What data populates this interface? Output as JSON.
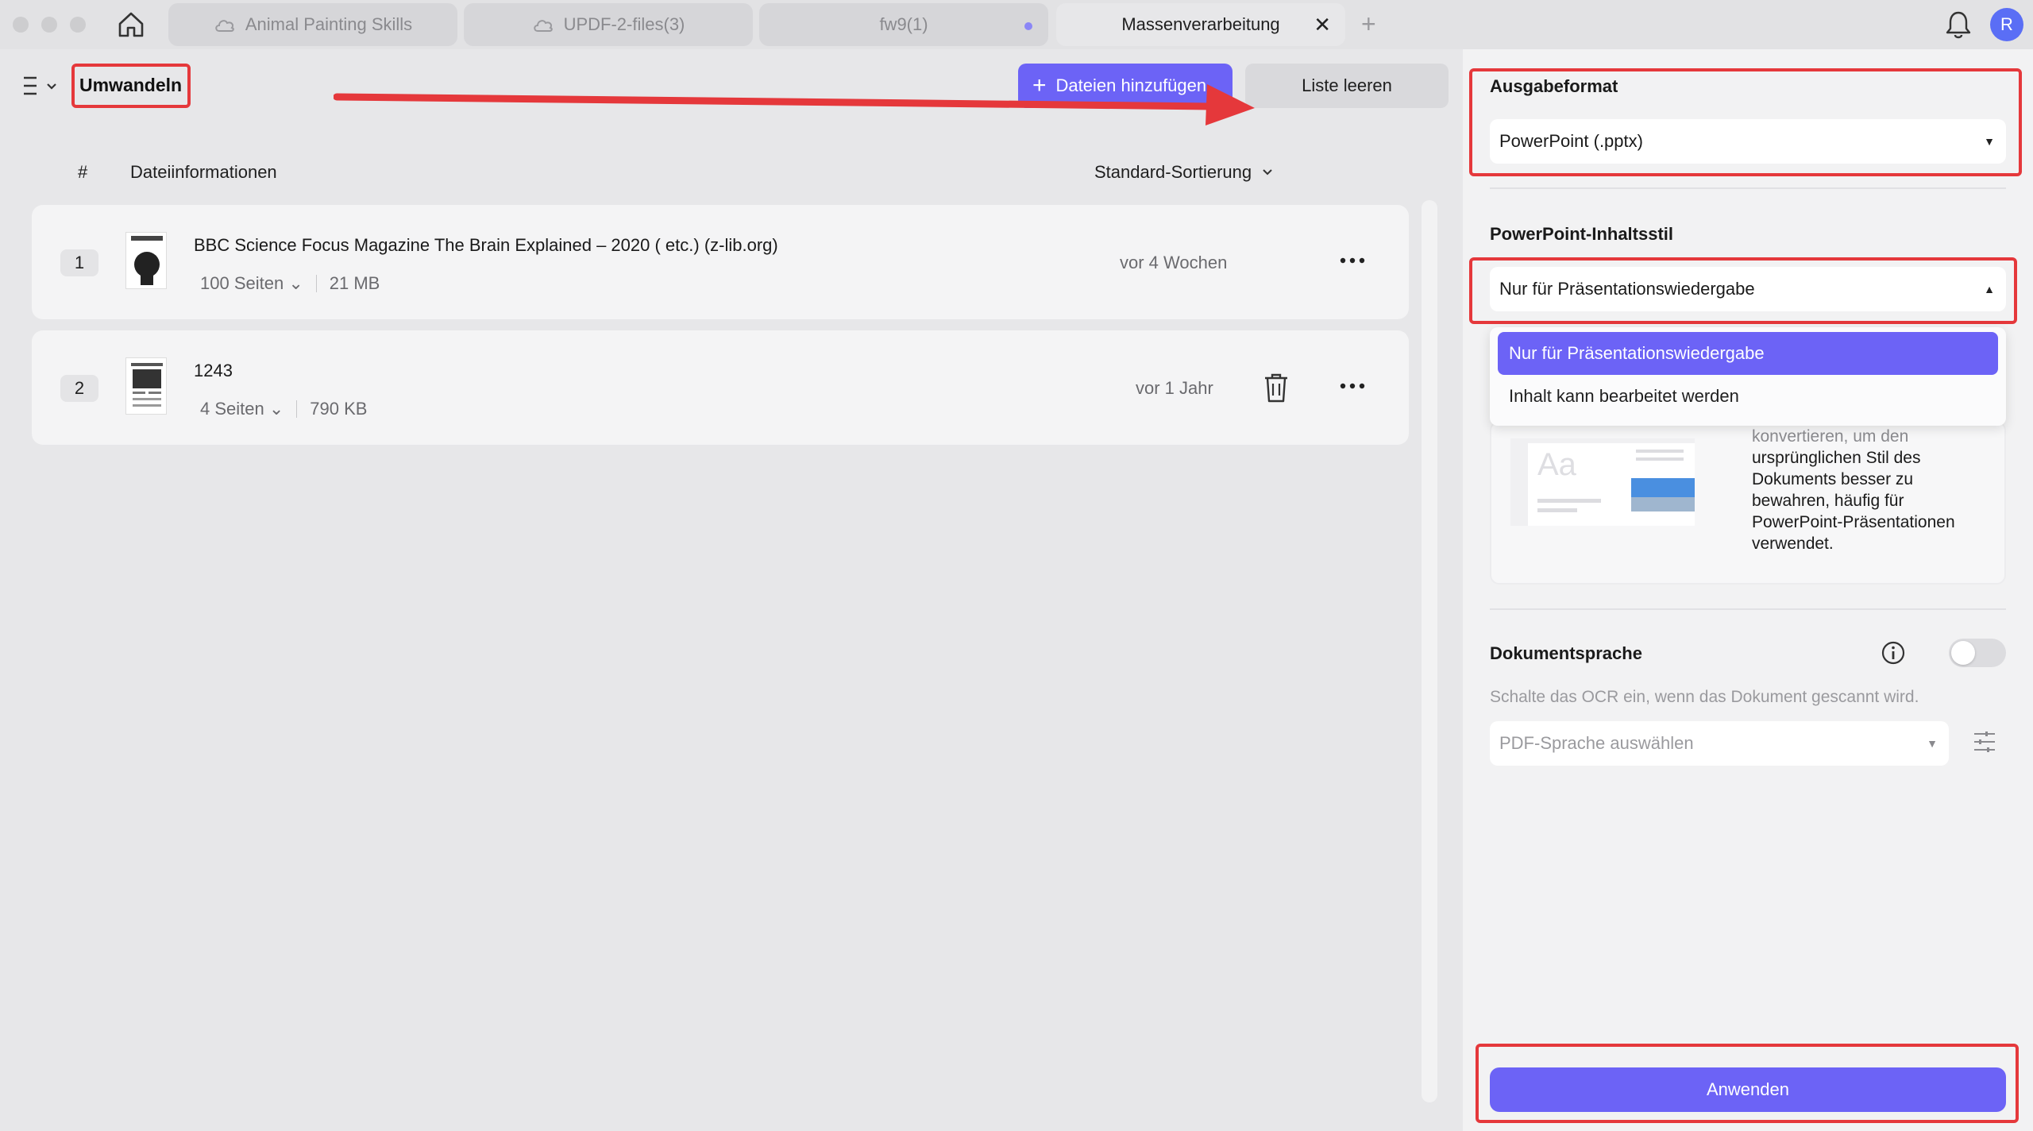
{
  "tabs": [
    {
      "label": "Animal Painting Skills",
      "icon": "cloud-icon"
    },
    {
      "label": "UPDF-2-files(3)",
      "icon": "cloud-icon"
    },
    {
      "label": "fw9(1)"
    },
    {
      "label": "Massenverarbeitung",
      "active": true
    }
  ],
  "user": {
    "avatar_letter": "R"
  },
  "left": {
    "title": "Umwandeln",
    "add_button": "Dateien hinzufügen",
    "clear_button": "Liste leeren",
    "col_hash": "#",
    "col_info": "Dateiinformationen",
    "sort_label": "Standard-Sortierung",
    "files": [
      {
        "num": "1",
        "name": "BBC Science Focus Magazine The Brain Explained – 2020 ( etc.) (z-lib.org)",
        "pages": "100 Seiten",
        "size": "21 MB",
        "date": "vor 4 Wochen"
      },
      {
        "num": "2",
        "name": "1243",
        "pages": "4 Seiten",
        "size": "790 KB",
        "date": "vor 1 Jahr"
      }
    ]
  },
  "right": {
    "format_label": "Ausgabeformat",
    "format_value": "PowerPoint (.pptx)",
    "style_label": "PowerPoint-Inhaltsstil",
    "style_value": "Nur für Präsentationswiedergabe",
    "dropdown_options": [
      "Nur für Präsentationswiedergabe",
      "Inhalt kann bearbeitet werden"
    ],
    "description_faded": "konvertieren, um den",
    "description": "ursprünglichen Stil des Dokuments besser zu bewahren, häufig für PowerPoint-Präsentationen verwendet.",
    "language_label": "Dokumentsprache",
    "ocr_hint": "Schalte das OCR ein, wenn das Dokument gescannt wird.",
    "language_placeholder": "PDF-Sprache auswählen",
    "apply_button": "Anwenden"
  },
  "colors": {
    "accent": "#6c63f6",
    "highlight": "#e5383b"
  }
}
